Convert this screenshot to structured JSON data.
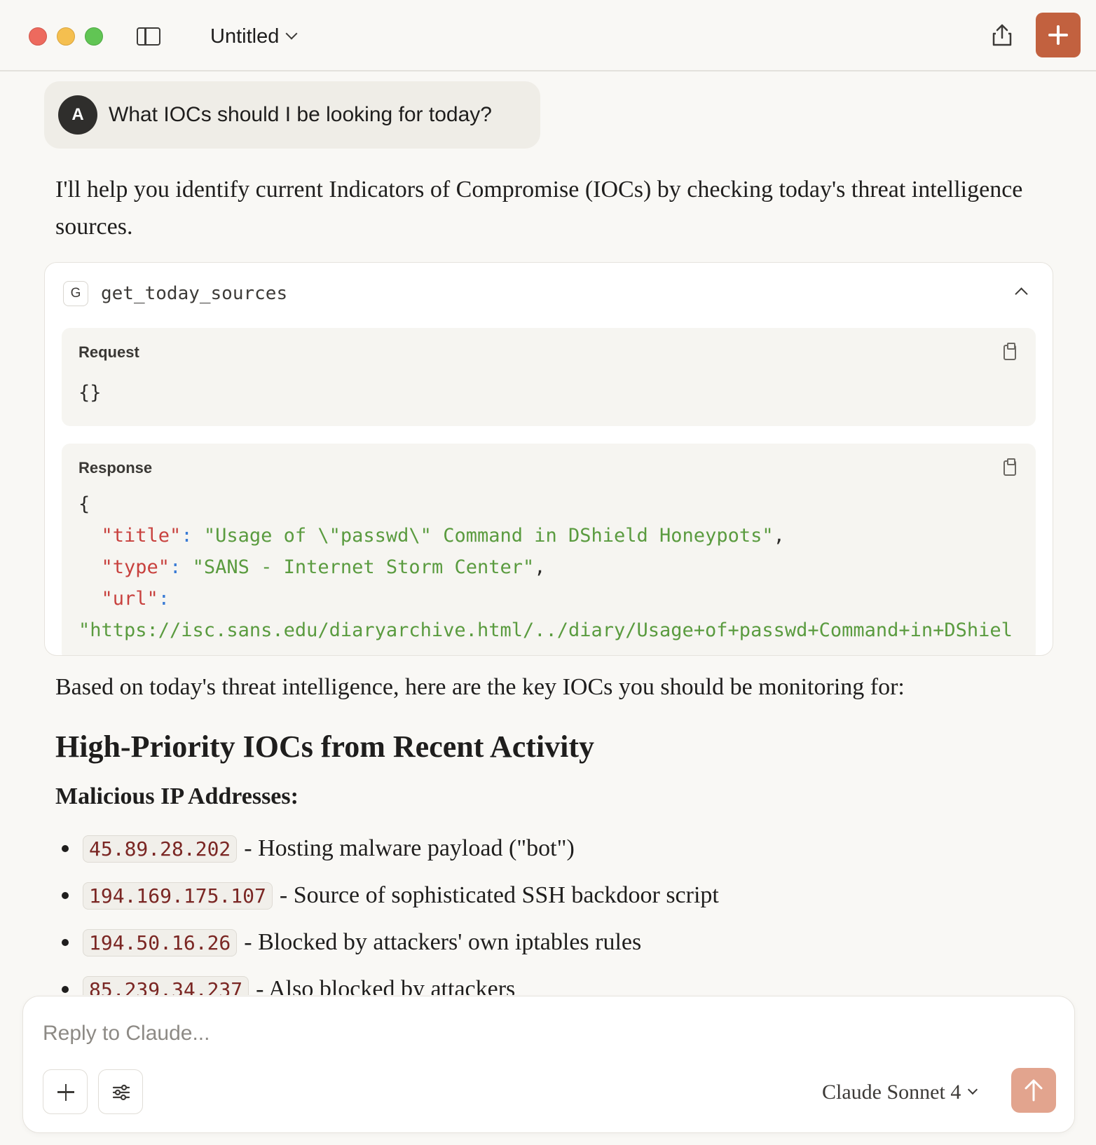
{
  "titlebar": {
    "doc_title": "Untitled"
  },
  "colors": {
    "accent": "#c2613f",
    "send_disabled": "#e2a48e",
    "json_key": "#c8413e",
    "json_string": "#5a9b3f",
    "json_punct": "#3a7bd5"
  },
  "user_message": {
    "avatar_initial": "A",
    "text": "What IOCs should I be looking for today?"
  },
  "assistant": {
    "intro": "I'll help you identify current Indicators of Compromise (IOCs) by checking today's threat intelligence sources.",
    "tool_call": {
      "badge": "G",
      "name": "get_today_sources",
      "request_label": "Request",
      "request_body": "{}",
      "response_label": "Response",
      "response_open": "{",
      "lines": [
        {
          "key": "\"title\"",
          "value": "\"Usage of \\\"passwd\\\" Command in DShield Honeypots\"",
          "tail": ","
        },
        {
          "key": "\"type\"",
          "value": "\"SANS - Internet Storm Center\"",
          "tail": ","
        },
        {
          "key": "\"url\"",
          "value": "",
          "tail": ""
        }
      ],
      "url_value": "\"https://isc.sans.edu/diaryarchive.html/../diary/Usage+of+passwd+Command+in+DShiel"
    },
    "based_text": "Based on today's threat intelligence, here are the key IOCs you should be monitoring for:",
    "heading": "High-Priority IOCs from Recent Activity",
    "subheading": "Malicious IP Addresses:",
    "iocs": [
      {
        "ip": "45.89.28.202",
        "desc": "- Hosting malware payload (\"bot\")"
      },
      {
        "ip": "194.169.175.107",
        "desc": "- Source of sophisticated SSH backdoor script"
      },
      {
        "ip": "194.50.16.26",
        "desc": "- Blocked by attackers' own iptables rules"
      },
      {
        "ip": "85.239.34.237",
        "desc": "- Also blocked by attackers"
      }
    ]
  },
  "composer": {
    "placeholder": "Reply to Claude...",
    "model_name_bold": "Claude",
    "model_name_rest": "Sonnet 4",
    "icons": {
      "attach": "plus-icon",
      "tools": "sliders-icon",
      "send": "arrow-up-icon"
    }
  }
}
